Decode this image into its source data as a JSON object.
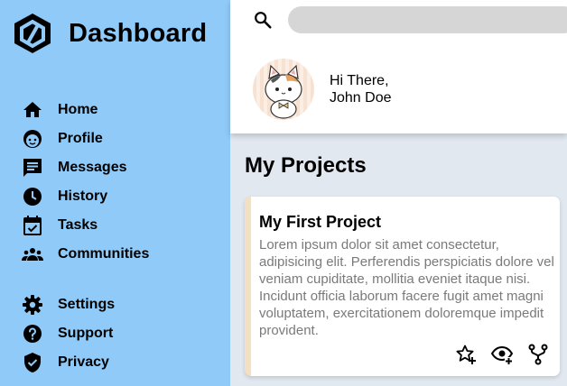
{
  "brand": {
    "title": "Dashboard",
    "logo_icon": "hexagon-logo-icon"
  },
  "nav_primary": [
    {
      "label": "Home",
      "icon": "home-icon"
    },
    {
      "label": "Profile",
      "icon": "face-icon"
    },
    {
      "label": "Messages",
      "icon": "chat-icon"
    },
    {
      "label": "History",
      "icon": "clock-icon"
    },
    {
      "label": "Tasks",
      "icon": "calendar-check-icon"
    },
    {
      "label": "Communities",
      "icon": "people-icon"
    }
  ],
  "nav_secondary": [
    {
      "label": "Settings",
      "icon": "gear-icon"
    },
    {
      "label": "Support",
      "icon": "help-icon"
    },
    {
      "label": "Privacy",
      "icon": "shield-icon"
    }
  ],
  "header": {
    "search_placeholder": "",
    "search_value": "",
    "greeting_line1": "Hi There,",
    "greeting_line2": "John Doe"
  },
  "main": {
    "section_title": "My Projects",
    "projects": [
      {
        "title": "My First Project",
        "description": "Lorem ipsum dolor sit amet consectetur, adipisicing elit. Perferendis perspiciatis dolore vel veniam cupiditate, mollitia eveniet itaque nisi. Incidunt officia laborum facere fugit amet magni voluptatem, exercitationem doloremque impedit provident.",
        "actions": [
          "star-add-icon",
          "watch-icon",
          "fork-icon"
        ]
      }
    ]
  },
  "colors": {
    "sidebar": "#8fcaf8",
    "background": "#e2e8f0",
    "card_accent": "#f3dfc1",
    "search_bg": "#d6d6d6"
  }
}
